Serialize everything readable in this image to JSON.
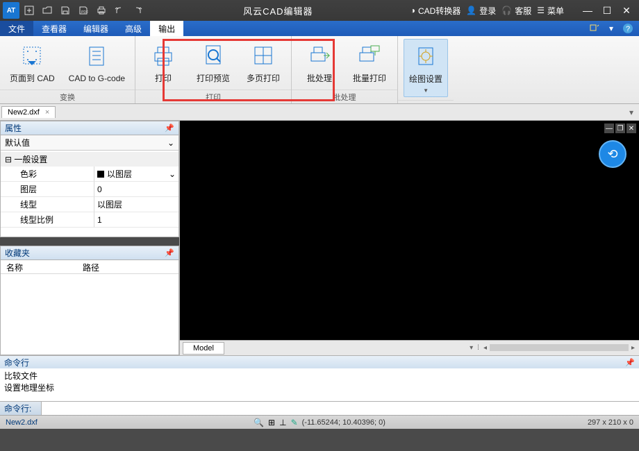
{
  "titlebar": {
    "title": "风云CAD编辑器",
    "links": {
      "converter": "CAD转换器",
      "login": "登录",
      "support": "客服",
      "menu": "菜单"
    }
  },
  "menubar": {
    "tabs": [
      "文件",
      "查看器",
      "编辑器",
      "高级",
      "输出"
    ]
  },
  "ribbon": {
    "groups": [
      {
        "label": "变换",
        "items": [
          "页面到 CAD",
          "CAD to G-code"
        ]
      },
      {
        "label": "打印",
        "items": [
          "打印",
          "打印预览",
          "多页打印"
        ]
      },
      {
        "label": "批处理",
        "items": [
          "批处理",
          "批量打印"
        ]
      },
      {
        "label": "",
        "items": [
          "绘图设置"
        ]
      }
    ]
  },
  "docTabs": {
    "active": "New2.dxf"
  },
  "properties": {
    "title": "属性",
    "default": "默认值",
    "category": "一般设置",
    "rows": [
      {
        "label": "色彩",
        "value": "以图层"
      },
      {
        "label": "图层",
        "value": "0"
      },
      {
        "label": "线型",
        "value": "以图层"
      },
      {
        "label": "线型比例",
        "value": "1"
      }
    ]
  },
  "favorites": {
    "title": "收藏夹",
    "cols": [
      "名称",
      "路径"
    ]
  },
  "modelTabs": {
    "active": "Model"
  },
  "commandPanel": {
    "title": "命令行",
    "history": [
      "比较文件",
      "设置地理坐标"
    ],
    "prompt": "命令行:"
  },
  "statusbar": {
    "file": "New2.dxf",
    "coords": "(-11.65244; 10.40396; 0)",
    "dims": "297 x 210 x 0"
  }
}
